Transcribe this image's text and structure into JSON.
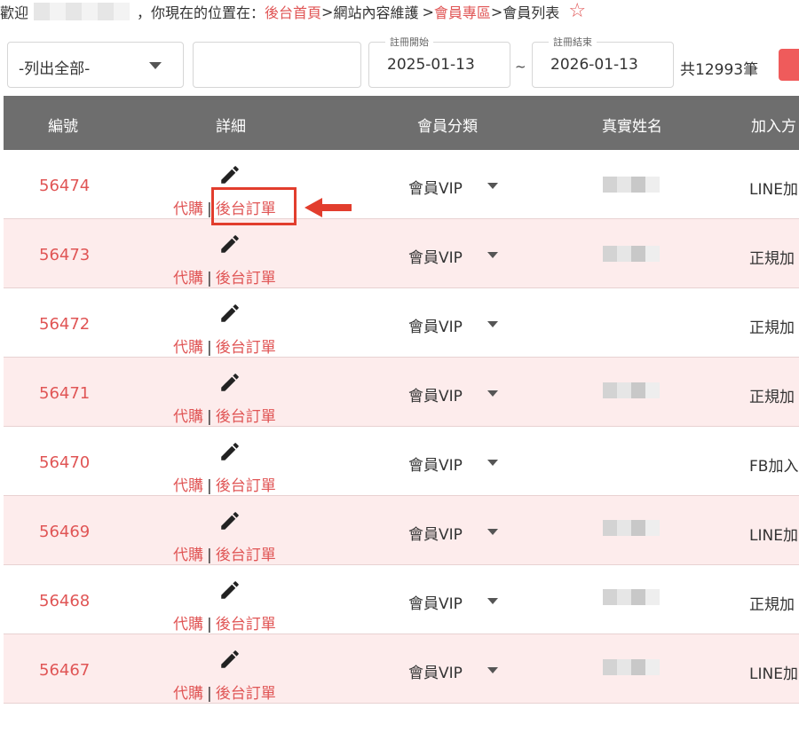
{
  "breadcrumb": {
    "welcome": "歡迎",
    "location_prefix": "，你現在的位置在：",
    "home": "後台首頁",
    "sep1": ">",
    "section": "網站內容維護",
    "sep2": ">",
    "member_area": "會員專區",
    "sep3": ">",
    "current": "會員列表",
    "star_icon": "☆"
  },
  "filters": {
    "category_select": "-列出全部-",
    "keyword_value": "",
    "reg_start_label": "註冊開始",
    "reg_start_value": "2025-01-13",
    "date_sep": "~",
    "reg_end_label": "註冊結束",
    "reg_end_value": "2026-01-13",
    "total_count": "共12993筆"
  },
  "table": {
    "headers": [
      "編號",
      "詳細",
      "會員分類",
      "真實姓名",
      "加入方"
    ],
    "link_proxy": "代購",
    "link_separator": "|",
    "link_backend_order": "後台訂單",
    "rows": [
      {
        "id": "56474",
        "group": "會員VIP",
        "join": "LINE加"
      },
      {
        "id": "56473",
        "group": "會員VIP",
        "join": "正規加"
      },
      {
        "id": "56472",
        "group": "會員VIP",
        "join": "正規加"
      },
      {
        "id": "56471",
        "group": "會員VIP",
        "join": "正規加"
      },
      {
        "id": "56470",
        "group": "會員VIP",
        "join": "FB加入"
      },
      {
        "id": "56469",
        "group": "會員VIP",
        "join": "LINE加"
      },
      {
        "id": "56468",
        "group": "會員VIP",
        "join": "正規加"
      },
      {
        "id": "56467",
        "group": "會員VIP",
        "join": "LINE加"
      }
    ]
  },
  "colors": {
    "accent": "#e05555",
    "header_bg": "#6e6e6e",
    "row_alt": "#fdecec",
    "annotation": "#e23d2d"
  }
}
